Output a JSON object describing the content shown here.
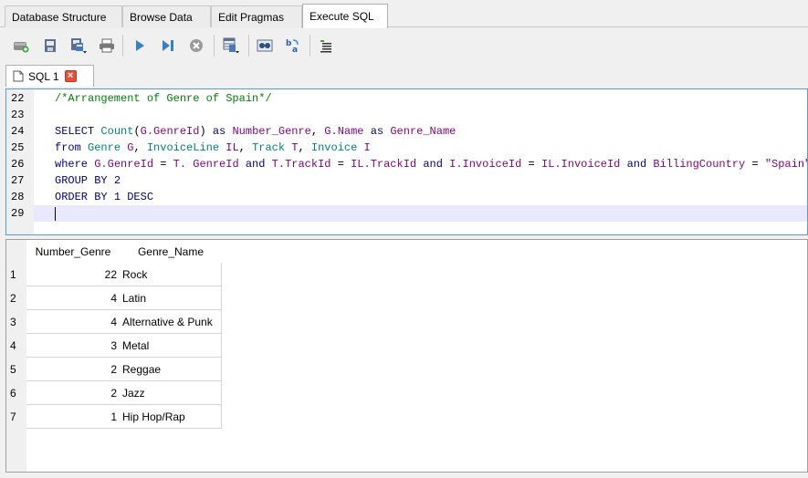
{
  "main_tabs": [
    {
      "label": "Database Structure"
    },
    {
      "label": "Browse Data"
    },
    {
      "label": "Edit Pragmas"
    },
    {
      "label": "Execute SQL"
    }
  ],
  "active_tab": "Execute SQL",
  "toolbar": {
    "icons": [
      "open-tab-icon",
      "open-sql-icon",
      "save-sql-icon",
      "print-icon",
      "execute-all-icon",
      "execute-line-icon",
      "stop-icon",
      "save-results-icon",
      "find-icon",
      "find-replace-icon",
      "comment-icon"
    ]
  },
  "sql_tab": {
    "label": "SQL 1"
  },
  "editor": {
    "line_numbers": [
      "22",
      "23",
      "24",
      "25",
      "26",
      "27",
      "28",
      "29"
    ],
    "comment": "/*Arrangement of Genre of Spain*/",
    "select": {
      "kw1": "SELECT",
      "fn": "Count",
      "arg": "G.GenreId",
      "as1": "as",
      "alias1": "Number_Genre",
      "gname": "G.Name",
      "as2": "as",
      "alias2": "Genre_Name"
    },
    "from": {
      "kw": "from",
      "t1": "Genre",
      "a1": "G",
      "t2": "InvoiceLine",
      "a2": "IL",
      "t3": "Track",
      "a3": "T",
      "t4": "Invoice",
      "a4": "I"
    },
    "where": {
      "kw": "where",
      "c1l": "G.GenreId",
      "c1r": "T. GenreId",
      "and1": "and",
      "c2l": "T.TrackId",
      "c2r": "IL.TrackId",
      "and2": "and",
      "c3l": "I.InvoiceId",
      "c3r": "IL.InvoiceId",
      "and3": "and",
      "c4l": "BillingCountry",
      "c4r": "\"Spain\""
    },
    "group": {
      "kw": "GROUP BY",
      "val": "2"
    },
    "order": {
      "kw": "ORDER BY",
      "val": "1",
      "dir": "DESC"
    }
  },
  "results": {
    "columns": [
      "Number_Genre",
      "Genre_Name"
    ],
    "rows": [
      {
        "n": "1",
        "count": "22",
        "name": "Rock"
      },
      {
        "n": "2",
        "count": "4",
        "name": "Latin"
      },
      {
        "n": "3",
        "count": "4",
        "name": "Alternative & Punk"
      },
      {
        "n": "4",
        "count": "3",
        "name": "Metal"
      },
      {
        "n": "5",
        "count": "2",
        "name": "Reggae"
      },
      {
        "n": "6",
        "count": "2",
        "name": "Jazz"
      },
      {
        "n": "7",
        "count": "1",
        "name": "Hip Hop/Rap"
      }
    ]
  }
}
